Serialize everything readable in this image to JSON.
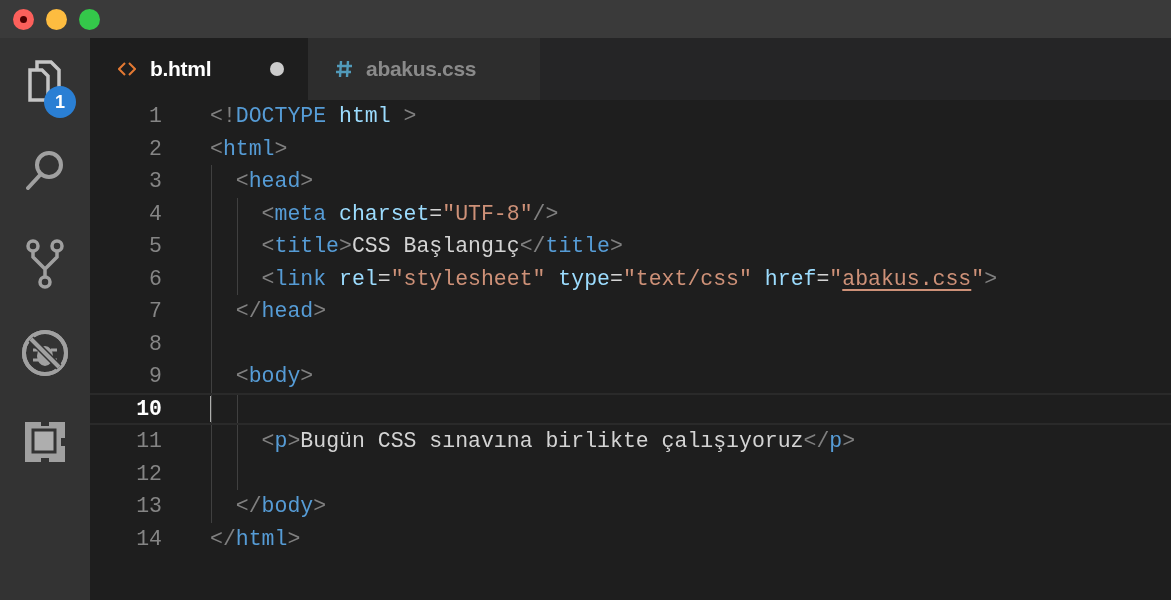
{
  "activity_bar": [
    {
      "kind": "files",
      "selected": true,
      "badge": "1"
    },
    {
      "kind": "search",
      "selected": false
    },
    {
      "kind": "source-control",
      "selected": false
    },
    {
      "kind": "debug",
      "selected": false
    },
    {
      "kind": "extensions",
      "selected": false
    }
  ],
  "tabs": [
    {
      "kind": "html",
      "label": "b.html",
      "selected": true,
      "modified": true
    },
    {
      "kind": "css",
      "label": "abakus.css",
      "selected": false,
      "modified": false
    }
  ],
  "editor": {
    "lines": [
      {
        "number": "1",
        "cursor": false,
        "tokens": [
          {
            "kind": "punct",
            "text": "<!"
          },
          {
            "kind": "tag",
            "text": "DOCTYPE"
          },
          {
            "kind": "attr",
            "text": " html"
          },
          {
            "kind": "punct",
            "text": " >"
          }
        ]
      },
      {
        "number": "2",
        "cursor": false,
        "tokens": [
          {
            "kind": "punct",
            "text": "<"
          },
          {
            "kind": "tag",
            "text": "html"
          },
          {
            "kind": "punct",
            "text": ">"
          }
        ]
      },
      {
        "number": "3",
        "cursor": false,
        "tokens": [
          {
            "kind": "punct",
            "text": "  <"
          },
          {
            "kind": "tag",
            "text": "head"
          },
          {
            "kind": "punct",
            "text": ">"
          }
        ]
      },
      {
        "number": "4",
        "cursor": false,
        "tokens": [
          {
            "kind": "punct",
            "text": "    <"
          },
          {
            "kind": "tag",
            "text": "meta"
          },
          {
            "kind": "attr",
            "text": " charset"
          },
          {
            "kind": "text",
            "text": "="
          },
          {
            "kind": "string",
            "text": "\"UTF-8\""
          },
          {
            "kind": "punct",
            "text": "/>"
          }
        ]
      },
      {
        "number": "5",
        "cursor": false,
        "tokens": [
          {
            "kind": "punct",
            "text": "    <"
          },
          {
            "kind": "tag",
            "text": "title"
          },
          {
            "kind": "punct",
            "text": ">"
          },
          {
            "kind": "text",
            "text": "CSS Başlangıç"
          },
          {
            "kind": "punct",
            "text": "</"
          },
          {
            "kind": "tag",
            "text": "title"
          },
          {
            "kind": "punct",
            "text": ">"
          }
        ]
      },
      {
        "number": "6",
        "cursor": false,
        "tokens": [
          {
            "kind": "punct",
            "text": "    <"
          },
          {
            "kind": "tag",
            "text": "link"
          },
          {
            "kind": "attr",
            "text": " rel"
          },
          {
            "kind": "text",
            "text": "="
          },
          {
            "kind": "string",
            "text": "\"stylesheet\""
          },
          {
            "kind": "attr",
            "text": " type"
          },
          {
            "kind": "text",
            "text": "="
          },
          {
            "kind": "string",
            "text": "\"text/css\""
          },
          {
            "kind": "attr",
            "text": " href"
          },
          {
            "kind": "text",
            "text": "="
          },
          {
            "kind": "string",
            "text": "\""
          },
          {
            "kind": "link",
            "text": "abakus.css"
          },
          {
            "kind": "string",
            "text": "\""
          },
          {
            "kind": "punct",
            "text": ">"
          }
        ]
      },
      {
        "number": "7",
        "cursor": false,
        "tokens": [
          {
            "kind": "punct",
            "text": "  </"
          },
          {
            "kind": "tag",
            "text": "head"
          },
          {
            "kind": "punct",
            "text": ">"
          }
        ]
      },
      {
        "number": "8",
        "cursor": false
      },
      {
        "number": "9",
        "cursor": false,
        "tokens": [
          {
            "kind": "punct",
            "text": "  <"
          },
          {
            "kind": "tag",
            "text": "body"
          },
          {
            "kind": "punct",
            "text": ">"
          }
        ]
      },
      {
        "number": "10",
        "cursor": true
      },
      {
        "number": "11",
        "cursor": false,
        "tokens": [
          {
            "kind": "punct",
            "text": "    <"
          },
          {
            "kind": "tag",
            "text": "p"
          },
          {
            "kind": "punct",
            "text": ">"
          },
          {
            "kind": "text",
            "text": "Bugün CSS sınavına birlikte çalışıyoruz"
          },
          {
            "kind": "punct",
            "text": "</"
          },
          {
            "kind": "tag",
            "text": "p"
          },
          {
            "kind": "punct",
            "text": ">"
          }
        ]
      },
      {
        "number": "12",
        "cursor": false
      },
      {
        "number": "13",
        "cursor": false,
        "tokens": [
          {
            "kind": "punct",
            "text": "  </"
          },
          {
            "kind": "tag",
            "text": "body"
          },
          {
            "kind": "punct",
            "text": ">"
          }
        ]
      },
      {
        "number": "14",
        "cursor": false,
        "tokens": [
          {
            "kind": "punct",
            "text": "</"
          },
          {
            "kind": "tag",
            "text": "html"
          },
          {
            "kind": "punct",
            "text": ">"
          }
        ]
      }
    ]
  }
}
